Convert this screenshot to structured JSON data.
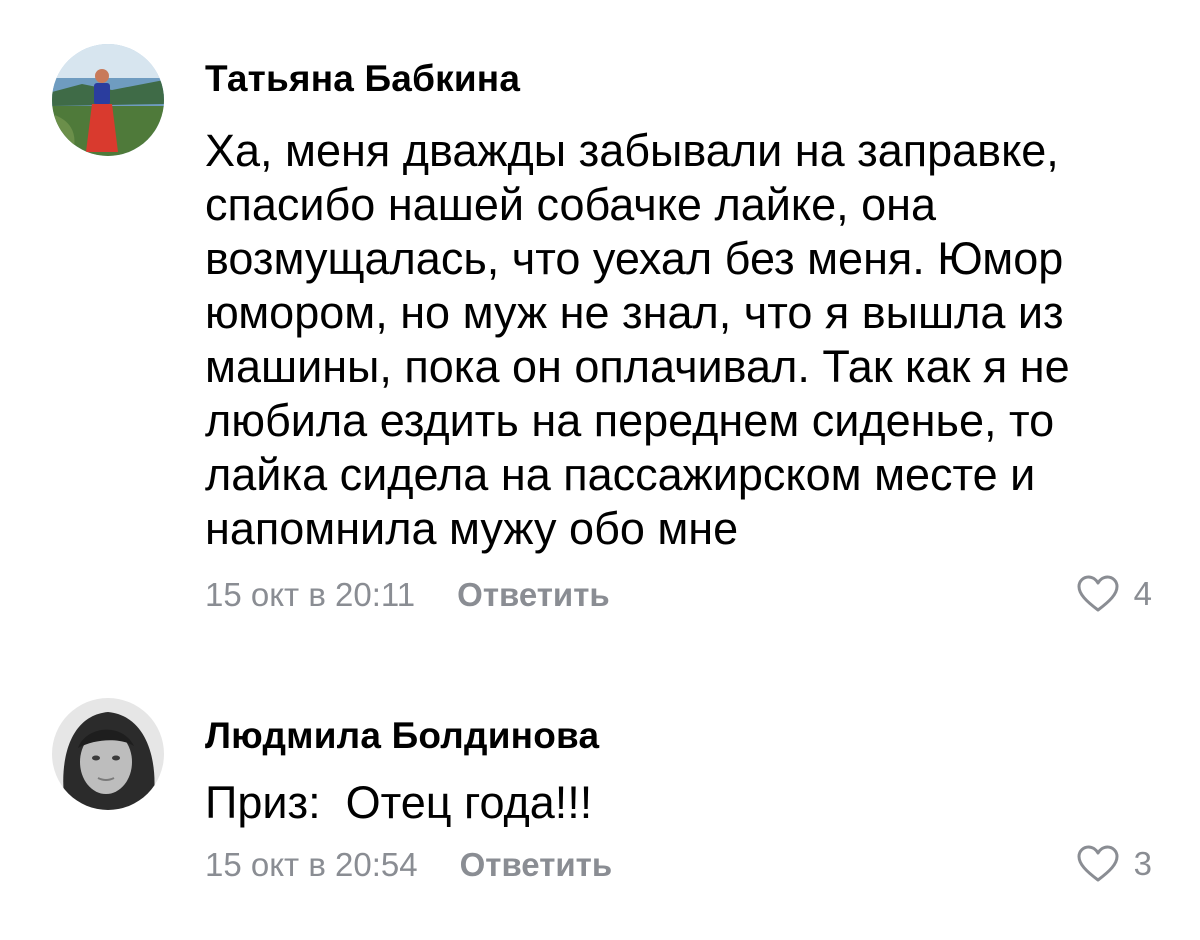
{
  "comments": [
    {
      "author": "Татьяна Бабкина",
      "text_lines": [
        "Ха, меня дважды забывали на заправке,",
        "спасибо нашей собачке лайке, она",
        "возмущалась, что уехал без меня. Юмор",
        "юмором, но муж не знал, что я вышла из",
        "машины, пока он оплачивал. Так как я не",
        "любила ездить на переднем сиденье, то",
        "лайка сидела на пассажирском месте и",
        "напомнила мужу обо мне"
      ],
      "timestamp": "15 окт в 20:11",
      "reply_label": "Ответить",
      "likes": "4",
      "like_icon": "heart-outline-icon"
    },
    {
      "author": "Людмила Болдинова",
      "text_lines": [
        "Приз:  Отец года!!!"
      ],
      "timestamp": "15 окт в 20:54",
      "reply_label": "Ответить",
      "likes": "3",
      "like_icon": "heart-outline-icon"
    }
  ],
  "colors": {
    "text": "#000000",
    "meta": "#8a8d93",
    "background": "#ffffff"
  }
}
